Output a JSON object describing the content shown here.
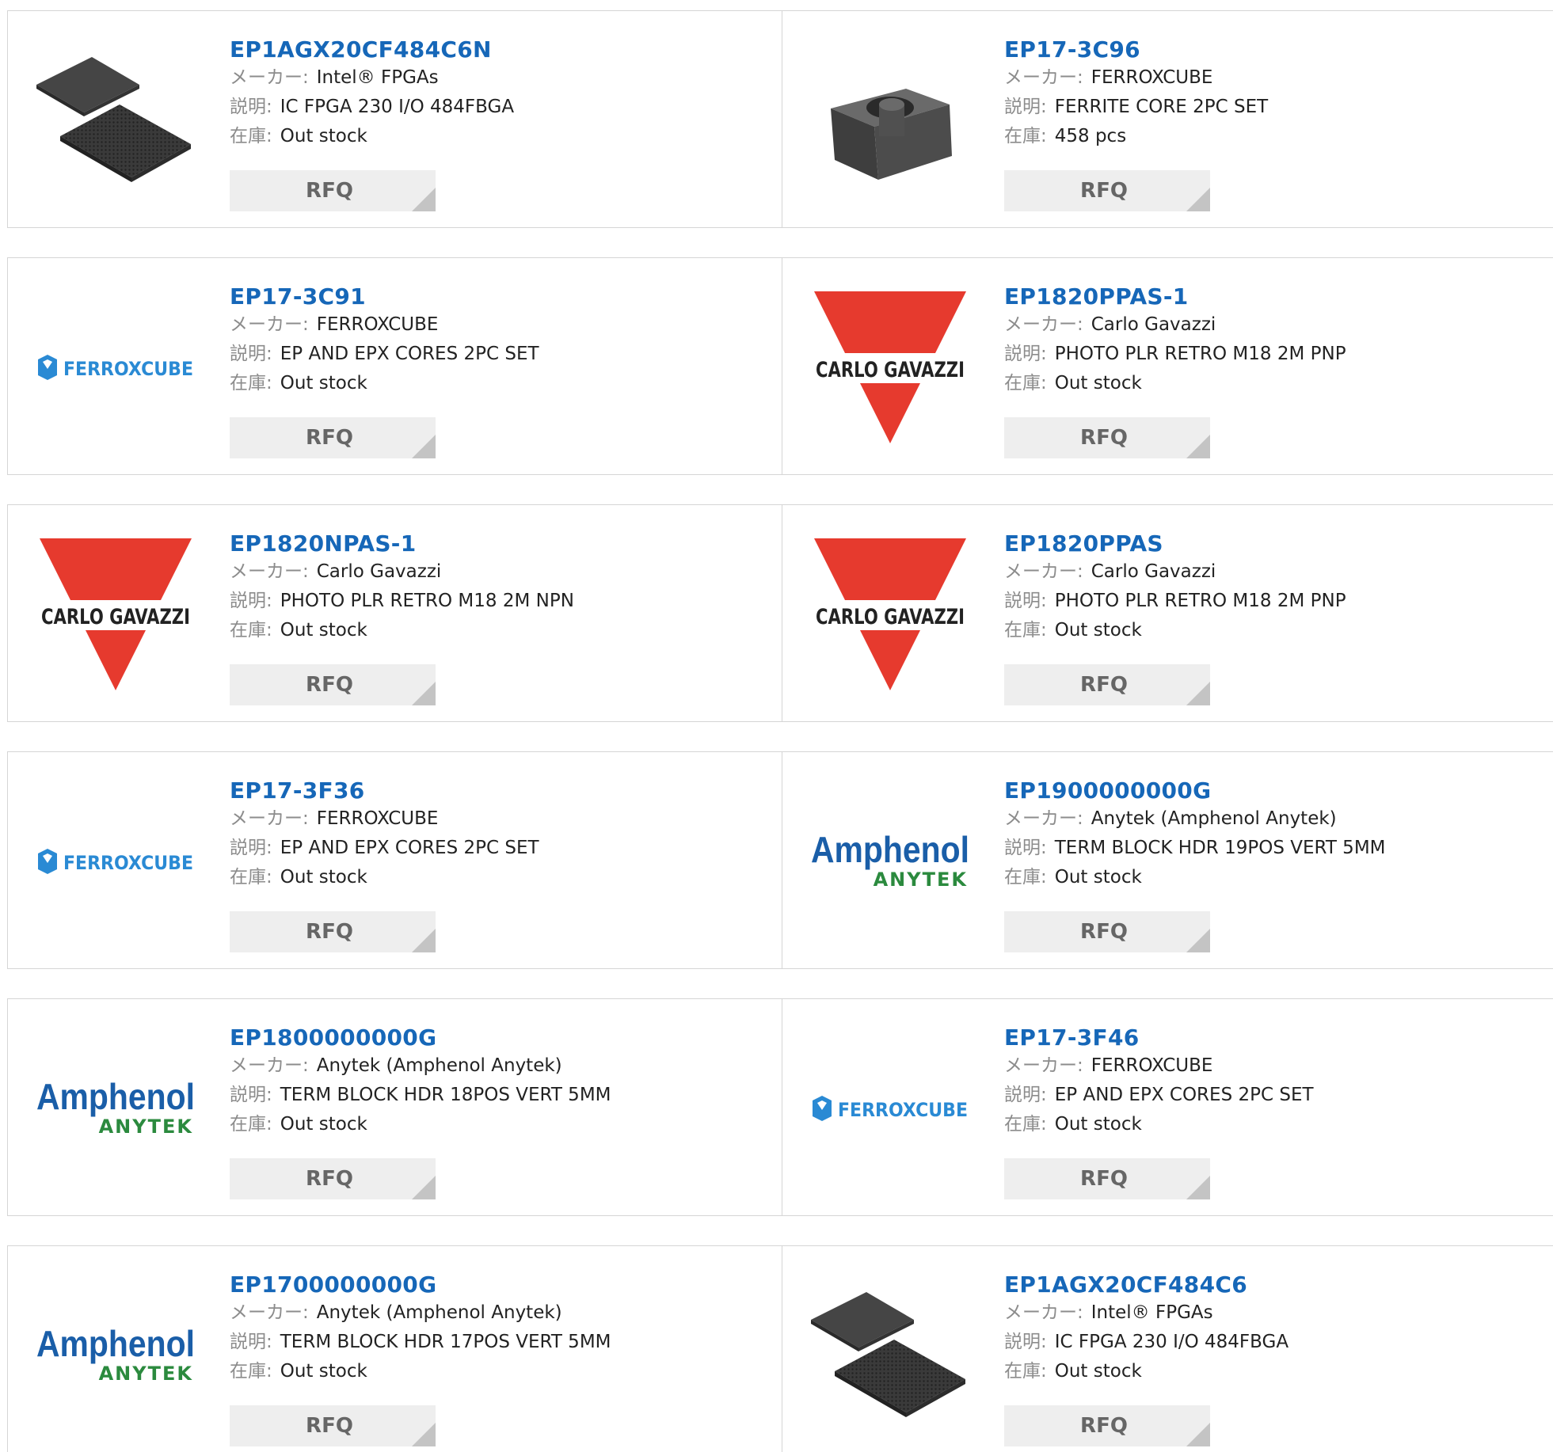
{
  "labels": {
    "maker": "メーカー:",
    "description": "説明:",
    "stock": "在庫:"
  },
  "rfq_label": "RFQ",
  "colors": {
    "link": "#1667b8",
    "cg_red": "#e63a2e",
    "amp_blue": "#1a5ea8",
    "amp_green": "#2b8a3e",
    "fx_blue": "#2a8ad4"
  },
  "products": [
    {
      "part": "EP1AGX20CF484C6N",
      "maker": "Intel® FPGAs",
      "description": "IC FPGA 230 I/O 484FBGA",
      "stock": "Out stock",
      "image": "chip"
    },
    {
      "part": "EP17-3C96",
      "maker": "FERROXCUBE",
      "description": "FERRITE CORE 2PC SET",
      "stock": "458 pcs",
      "image": "ferrite-core"
    },
    {
      "part": "EP17-3C91",
      "maker": "FERROXCUBE",
      "description": "EP AND EPX CORES 2PC SET",
      "stock": "Out stock",
      "image": "ferroxcube-logo"
    },
    {
      "part": "EP1820PPAS-1",
      "maker": "Carlo Gavazzi",
      "description": "PHOTO PLR RETRO M18 2M PNP",
      "stock": "Out stock",
      "image": "carlo-gavazzi-logo"
    },
    {
      "part": "EP1820NPAS-1",
      "maker": "Carlo Gavazzi",
      "description": "PHOTO PLR RETRO M18 2M NPN",
      "stock": "Out stock",
      "image": "carlo-gavazzi-logo"
    },
    {
      "part": "EP1820PPAS",
      "maker": "Carlo Gavazzi",
      "description": "PHOTO PLR RETRO M18 2M PNP",
      "stock": "Out stock",
      "image": "carlo-gavazzi-logo"
    },
    {
      "part": "EP17-3F36",
      "maker": "FERROXCUBE",
      "description": "EP AND EPX CORES 2PC SET",
      "stock": "Out stock",
      "image": "ferroxcube-logo"
    },
    {
      "part": "EP1900000000G",
      "maker": "Anytek (Amphenol Anytek)",
      "description": "TERM BLOCK HDR 19POS VERT 5MM",
      "stock": "Out stock",
      "image": "amphenol-logo"
    },
    {
      "part": "EP1800000000G",
      "maker": "Anytek (Amphenol Anytek)",
      "description": "TERM BLOCK HDR 18POS VERT 5MM",
      "stock": "Out stock",
      "image": "amphenol-logo"
    },
    {
      "part": "EP17-3F46",
      "maker": "FERROXCUBE",
      "description": "EP AND EPX CORES 2PC SET",
      "stock": "Out stock",
      "image": "ferroxcube-logo"
    },
    {
      "part": "EP1700000000G",
      "maker": "Anytek (Amphenol Anytek)",
      "description": "TERM BLOCK HDR 17POS VERT 5MM",
      "stock": "Out stock",
      "image": "amphenol-logo"
    },
    {
      "part": "EP1AGX20CF484C6",
      "maker": "Intel® FPGAs",
      "description": "IC FPGA 230 I/O 484FBGA",
      "stock": "Out stock",
      "image": "chip"
    }
  ],
  "logos": {
    "carlo_gavazzi": "CARLO GAVAZZI",
    "ferroxcube": "FERROXCUBE",
    "amphenol_top": "Amphenol",
    "amphenol_bottom": "ANYTEK"
  }
}
